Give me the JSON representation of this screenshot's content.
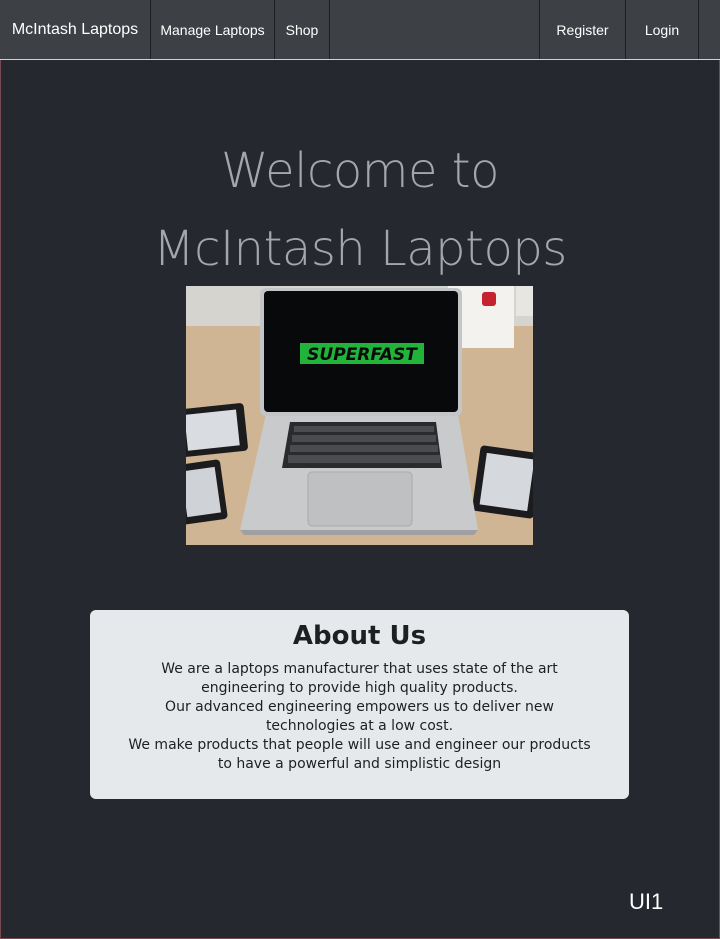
{
  "navbar": {
    "brand": "McIntash Laptops",
    "links": [
      "Manage Laptops",
      "Shop"
    ],
    "auth": {
      "register": "Register",
      "login": "Login"
    }
  },
  "hero": {
    "title_line1": "Welcome to",
    "title_line2": "McIntash Laptops",
    "image": {
      "screen_text": "SUPERFAST",
      "icon": "laptop-photo"
    }
  },
  "about": {
    "title": "About Us",
    "lines": [
      "We are a laptops manufacturer that uses state of the art",
      "engineering to provide high quality products.",
      "Our advanced engineering empowers us to deliver new",
      "technologies at a low cost.",
      "We make products that people will use and engineer our products",
      "to have a powerful and simplistic design"
    ]
  },
  "corner_tag": "UI1",
  "colors": {
    "background": "#25282e",
    "navbar": "#3d4146",
    "hero_text": "#a3a6aa",
    "card": "#e6e9ec",
    "accent_green": "#22b33a"
  }
}
